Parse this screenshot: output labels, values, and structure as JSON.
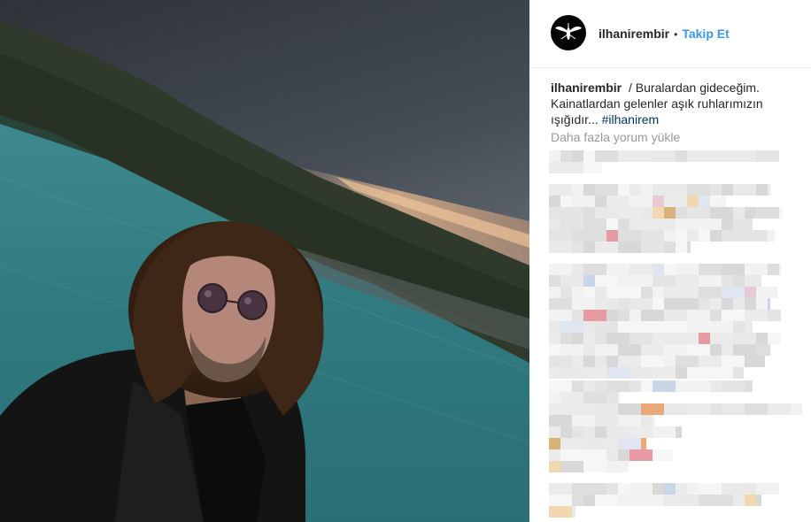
{
  "post": {
    "username": "ilhanirembir",
    "separator": "•",
    "follow_label": "Takip Et",
    "avatar_icon": "mosquito-icon",
    "caption": {
      "username": "ilhanirembir",
      "text": "/ Buralardan gideceğim. Kainatlardan gelenler aşık ruhlarımızın ışığıdır...",
      "hashtag": "#ilhanirem"
    },
    "load_more_comments": "Daha fazla yorum yükle"
  },
  "colors": {
    "link_blue": "#3897f0",
    "hashtag": "#003569",
    "muted": "#999999",
    "text": "#262626"
  }
}
